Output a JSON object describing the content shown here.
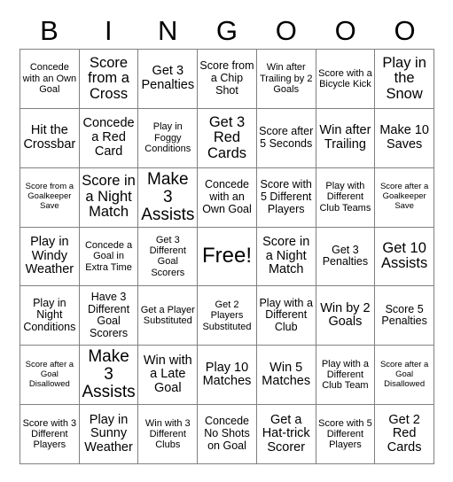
{
  "card": {
    "title": "BINGO",
    "columns": 7,
    "rows": 7,
    "header_letters": [
      "B",
      "I",
      "N",
      "G",
      "O",
      "O",
      "O"
    ],
    "free_space_label": "Free!",
    "free_space_position": {
      "row": 4,
      "column": 4
    },
    "colors": {
      "background": "#ffffff",
      "grid_line": "#808080",
      "text": "#000000"
    },
    "cells": [
      [
        {
          "text": "Concede with an Own Goal",
          "size": "fs-s"
        },
        {
          "text": "Score from a Cross",
          "size": "fs-xl"
        },
        {
          "text": "Get 3 Penalties",
          "size": "fs-l"
        },
        {
          "text": "Score from a Chip Shot",
          "size": "fs-m"
        },
        {
          "text": "Win after Trailing by 2 Goals",
          "size": "fs-s"
        },
        {
          "text": "Score with a Bicycle Kick",
          "size": "fs-s"
        },
        {
          "text": "Play in the Snow",
          "size": "fs-xl"
        }
      ],
      [
        {
          "text": "Hit the Crossbar",
          "size": "fs-l"
        },
        {
          "text": "Concede a Red Card",
          "size": "fs-l"
        },
        {
          "text": "Play in Foggy Conditions",
          "size": "fs-s"
        },
        {
          "text": "Get 3 Red Cards",
          "size": "fs-xl"
        },
        {
          "text": "Score after 5 Seconds",
          "size": "fs-m"
        },
        {
          "text": "Win after Trailing",
          "size": "fs-l"
        },
        {
          "text": "Make 10 Saves",
          "size": "fs-l"
        }
      ],
      [
        {
          "text": "Score from a Goalkeeper Save",
          "size": "fs-xs"
        },
        {
          "text": "Score in a Night Match",
          "size": "fs-xl"
        },
        {
          "text": "Make 3 Assists",
          "size": "fs-xxl"
        },
        {
          "text": "Concede with an Own Goal",
          "size": "fs-m"
        },
        {
          "text": "Score with 5 Different Players",
          "size": "fs-m"
        },
        {
          "text": "Play with Different Club Teams",
          "size": "fs-s"
        },
        {
          "text": "Score after a Goalkeeper Save",
          "size": "fs-xs"
        }
      ],
      [
        {
          "text": "Play in Windy Weather",
          "size": "fs-l"
        },
        {
          "text": "Concede a Goal in Extra Time",
          "size": "fs-s"
        },
        {
          "text": "Get 3 Different Goal Scorers",
          "size": "fs-s"
        },
        {
          "text": "Free!",
          "size": "fs-free"
        },
        {
          "text": "Score in a Night Match",
          "size": "fs-l"
        },
        {
          "text": "Get 3 Penalties",
          "size": "fs-m"
        },
        {
          "text": "Get 10 Assists",
          "size": "fs-xl"
        }
      ],
      [
        {
          "text": "Play in Night Conditions",
          "size": "fs-m"
        },
        {
          "text": "Have 3 Different Goal Scorers",
          "size": "fs-m"
        },
        {
          "text": "Get a Player Substituted",
          "size": "fs-s"
        },
        {
          "text": "Get 2 Players Substituted",
          "size": "fs-s"
        },
        {
          "text": "Play with a Different Club",
          "size": "fs-m"
        },
        {
          "text": "Win by 2 Goals",
          "size": "fs-l"
        },
        {
          "text": "Score 5 Penalties",
          "size": "fs-m"
        }
      ],
      [
        {
          "text": "Score after a Goal Disallowed",
          "size": "fs-xs"
        },
        {
          "text": "Make 3 Assists",
          "size": "fs-xxl"
        },
        {
          "text": "Win with a Late Goal",
          "size": "fs-l"
        },
        {
          "text": "Play 10 Matches",
          "size": "fs-l"
        },
        {
          "text": "Win 5 Matches",
          "size": "fs-l"
        },
        {
          "text": "Play with a Different Club Team",
          "size": "fs-s"
        },
        {
          "text": "Score after a Goal Disallowed",
          "size": "fs-xs"
        }
      ],
      [
        {
          "text": "Score with 3 Different Players",
          "size": "fs-s"
        },
        {
          "text": "Play in Sunny Weather",
          "size": "fs-l"
        },
        {
          "text": "Win with 3 Different Clubs",
          "size": "fs-s"
        },
        {
          "text": "Concede No Shots on Goal",
          "size": "fs-m"
        },
        {
          "text": "Get a Hat-trick Scorer",
          "size": "fs-l"
        },
        {
          "text": "Score with 5 Different Players",
          "size": "fs-s"
        },
        {
          "text": "Get 2 Red Cards",
          "size": "fs-l"
        }
      ]
    ]
  }
}
